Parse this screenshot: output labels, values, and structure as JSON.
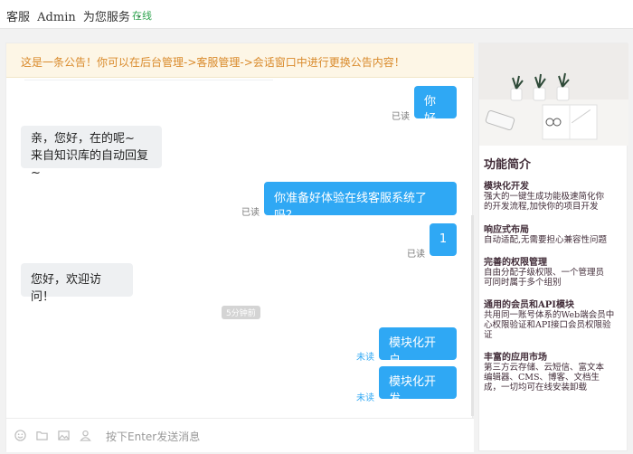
{
  "header": {
    "service_label": "客服",
    "agent_name": "Admin",
    "serving_text": "为您服务",
    "dot": "·",
    "status": "在线"
  },
  "notice": {
    "text": "这是一条公告！你可以在后台管理->客服管理->会话窗口中进行更换公告内容！"
  },
  "messages": [
    {
      "text": "你好",
      "stamp": "已读"
    },
    {
      "line1": "亲，您好，在的呢~",
      "line2": "来自知识库的自动回复~"
    },
    {
      "text": "你准备好体验在线客服系统了吗？",
      "stamp": "已读"
    },
    {
      "text": "1",
      "stamp": "已读"
    },
    {
      "text": "您好，欢迎访问！"
    },
    {
      "text": "模块化开户",
      "stamp": "未读"
    },
    {
      "text": "模块化开发",
      "stamp": "未读"
    }
  ],
  "time_divider": "5分钟前",
  "input": {
    "placeholder": "按下Enter发送消息"
  },
  "tools": [
    "emoji-icon",
    "folder-icon",
    "image-icon",
    "user-icon"
  ],
  "sidebar": {
    "title": "功能简介",
    "features": [
      {
        "title": "模块化开发",
        "desc": [
          "强大的一键生成功能极速简化你",
          "的开发流程,加快你的项目开发"
        ]
      },
      {
        "title": "响应式布局",
        "desc": [
          "自动适配,无需要担心兼容性问题"
        ]
      },
      {
        "title": "完善的权限管理",
        "desc": [
          "自由分配子级权限、一个管理员",
          "可同时属于多个组别"
        ]
      },
      {
        "title": "通用的会员和API模块",
        "desc": [
          "共用同一账号体系的Web端会员中",
          "心权限验证和API接口会员权限验",
          "证"
        ]
      },
      {
        "title": "丰富的应用市场",
        "desc": [
          "第三方云存储、云短信、富文本",
          "编辑器、CMS、博客、文档生",
          "成，一切均可在线安装卸载"
        ]
      }
    ]
  },
  "colors": {
    "accent": "#2fa8f4",
    "online": "#2ea44f",
    "notice_text": "#d98a2b",
    "notice_bg": "#fdf6e6"
  }
}
